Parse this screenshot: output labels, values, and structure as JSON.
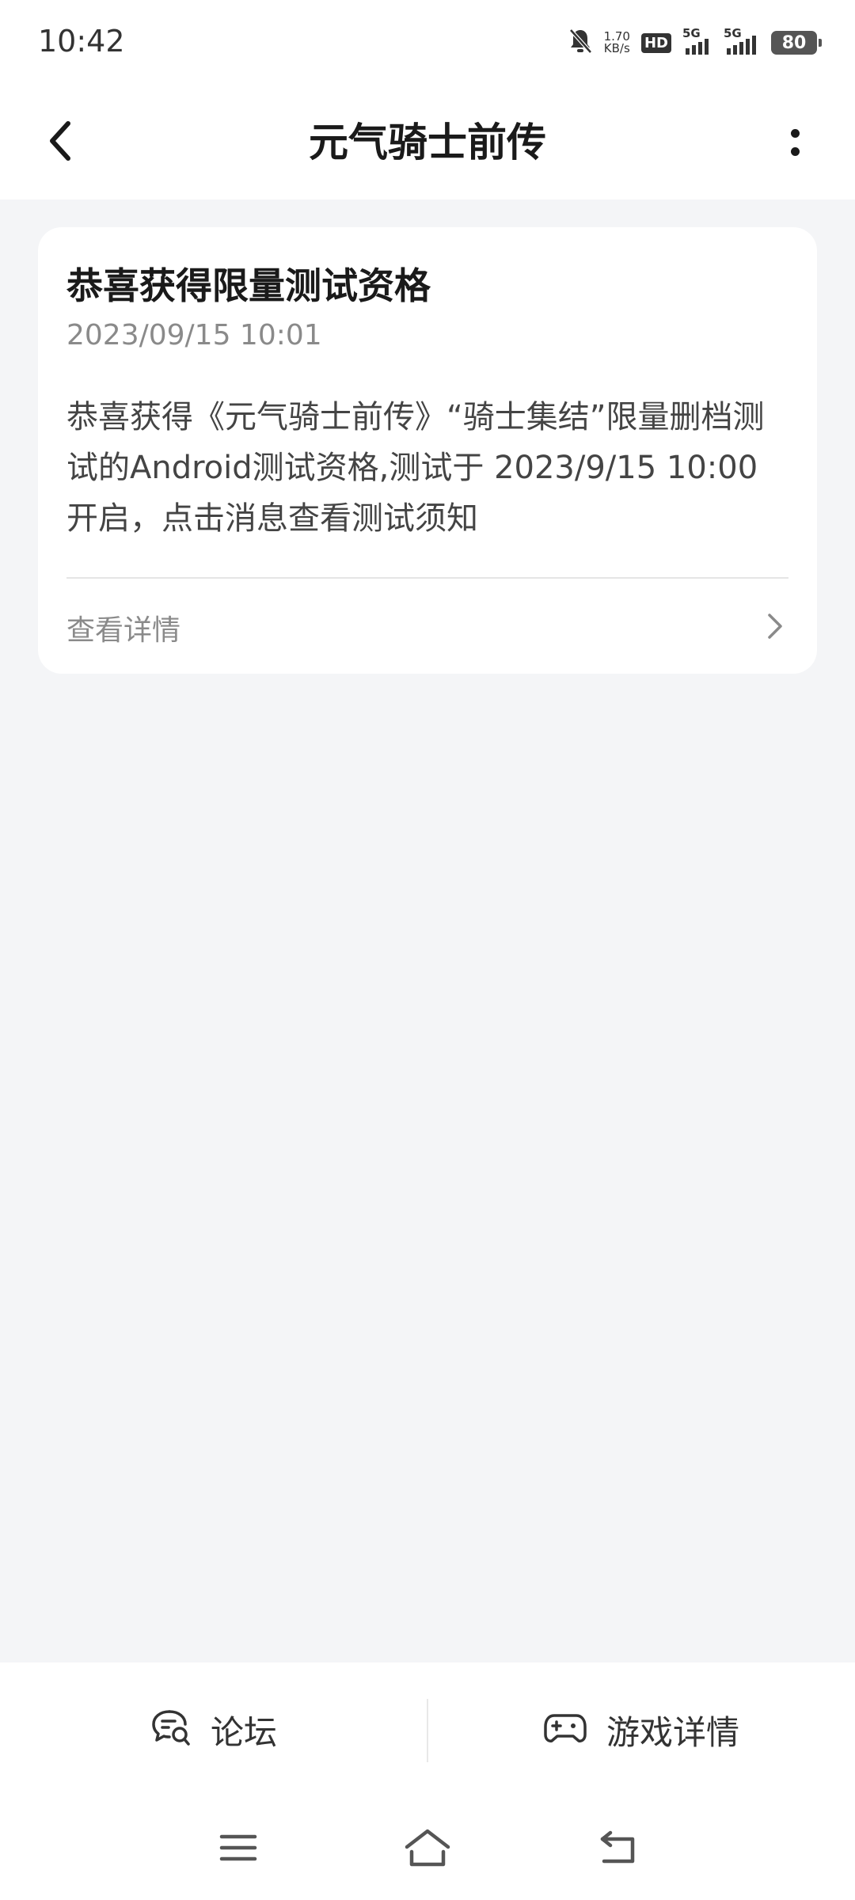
{
  "status_bar": {
    "time": "10:42",
    "net_speed_value": "1.70",
    "net_speed_unit": "KB/s",
    "hd_label": "HD",
    "sim1_label": "5G",
    "sim2_label": "5G",
    "battery": "80",
    "icons": [
      "bell-off-icon",
      "hd-icon",
      "signal-icon",
      "signal-icon",
      "battery-icon"
    ]
  },
  "header": {
    "title": "元气骑士前传",
    "back_icon": "chevron-left-icon",
    "more_icon": "more-vertical-icon"
  },
  "message": {
    "title": "恭喜获得限量测试资格",
    "date": "2023/09/15 10:01",
    "body": "恭喜获得《元气骑士前传》“骑士集结”限量删档测试的Android测试资格,测试于 2023/9/15 10:00 开启，点击消息查看测试须知",
    "link_label": "查看详情",
    "link_icon": "chevron-right-icon"
  },
  "bottom_actions": {
    "forum_label": "论坛",
    "forum_icon": "forum-icon",
    "game_details_label": "游戏详情",
    "game_details_icon": "gamepad-icon"
  },
  "system_nav": {
    "icons": [
      "menu-icon",
      "home-icon",
      "back-icon"
    ]
  },
  "colors": {
    "background": "#f4f5f7",
    "card": "#ffffff",
    "title_text": "#1a1a1a",
    "secondary_text": "#8a8a8a"
  }
}
